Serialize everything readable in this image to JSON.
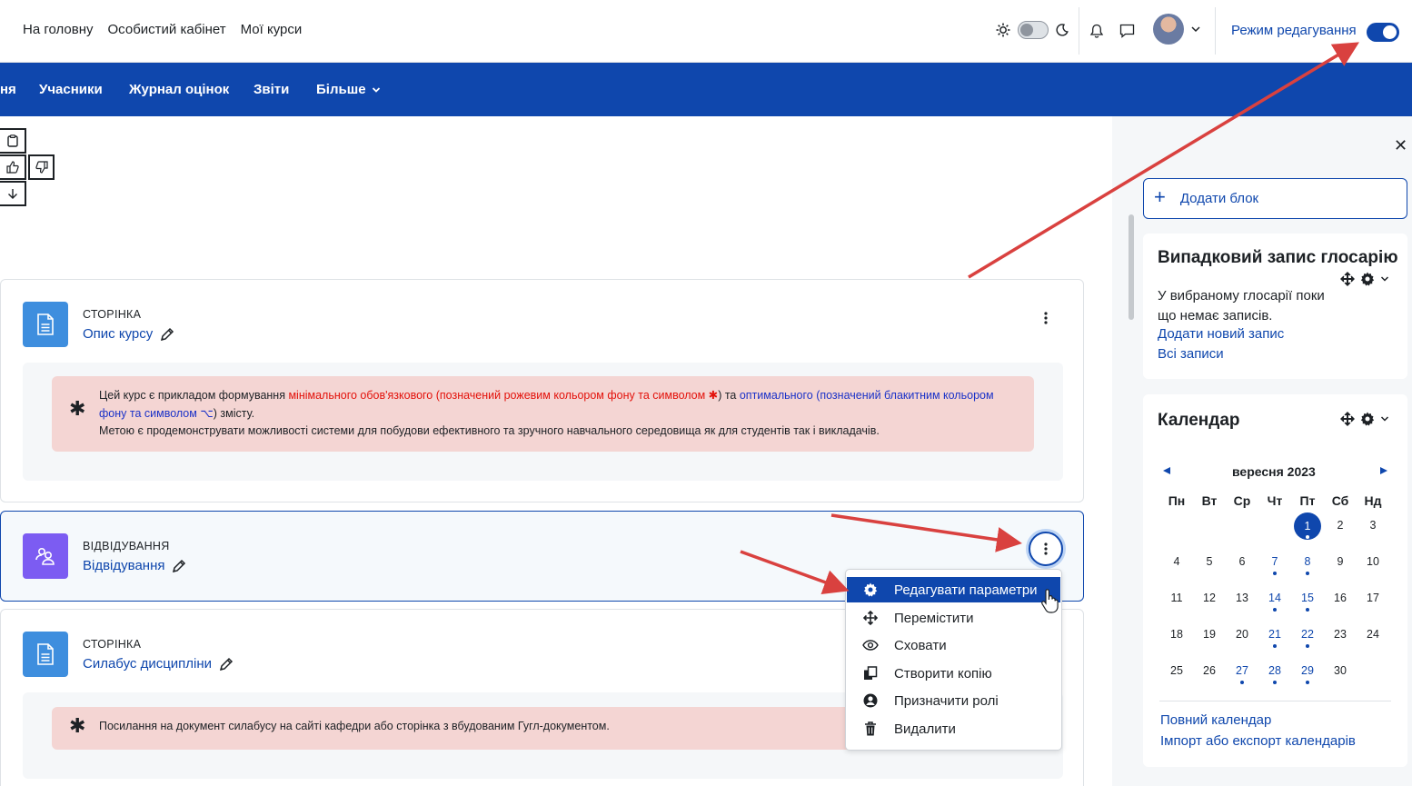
{
  "topbar": {
    "links": [
      "На головну",
      "Особистий кабінет",
      "Мої курси"
    ],
    "edit_mode_label": "Режим редагування"
  },
  "secnav": {
    "items": [
      "ня",
      "Учасники",
      "Журнал оцінок",
      "Звіти",
      "Більше"
    ]
  },
  "activities": [
    {
      "type": "СТОРІНКА",
      "name": "Опис курсу",
      "alert": {
        "p1": "Цей курс є прикладом формування ",
        "red": "мінімального обов'язкового (позначений рожевим кольором фону та символом ✱",
        "p2": ") та ",
        "blue": "оптимального (позначений блакитним кольором фону та символом ⌥",
        "p3": ") змісту.",
        "line2": "Метою є продемонструвати можливості системи для побудови ефективного та зручного навчального середовища як для студентів так і викладачів."
      }
    },
    {
      "type": "ВІДВІДУВАННЯ",
      "name": "Відвідування"
    },
    {
      "type": "СТОРІНКА",
      "name": "Силабус дисципліни",
      "alert": {
        "text": "Посилання на документ силабусу на сайті кафедри або сторінка з вбудованим Гугл-документом."
      }
    }
  ],
  "action_menu": {
    "items": [
      "Редагувати параметри",
      "Перемістити",
      "Сховати",
      "Створити копію",
      "Призначити ролі",
      "Видалити"
    ],
    "selected_index": 0
  },
  "drawer": {
    "add_block": "Додати блок",
    "glossary": {
      "title": "Випадковий запис глосарію",
      "empty_text": "У вибраному глосарії поки що немає записів.",
      "add_link": "Додати новий запис",
      "all_link": "Всі записи"
    },
    "calendar": {
      "title": "Календар",
      "month": "вересня 2023",
      "weekdays": [
        "Пн",
        "Вт",
        "Ср",
        "Чт",
        "Пт",
        "Сб",
        "Нд"
      ],
      "weeks": [
        [
          "",
          "",
          "",
          "",
          "1",
          "2",
          "3"
        ],
        [
          "4",
          "5",
          "6",
          "7",
          "8",
          "9",
          "10"
        ],
        [
          "11",
          "12",
          "13",
          "14",
          "15",
          "16",
          "17"
        ],
        [
          "18",
          "19",
          "20",
          "21",
          "22",
          "23",
          "24"
        ],
        [
          "25",
          "26",
          "27",
          "28",
          "29",
          "30",
          ""
        ]
      ],
      "event_days": [
        "7",
        "8",
        "14",
        "15",
        "21",
        "22",
        "27",
        "28",
        "29"
      ],
      "today": "1",
      "full_link": "Повний календар",
      "export_link": "Імпорт або експорт календарів"
    }
  },
  "colors": {
    "primary": "#0f47ad",
    "alert_pink": "#f4d5d3",
    "annotation_arrow": "#d9413f"
  }
}
